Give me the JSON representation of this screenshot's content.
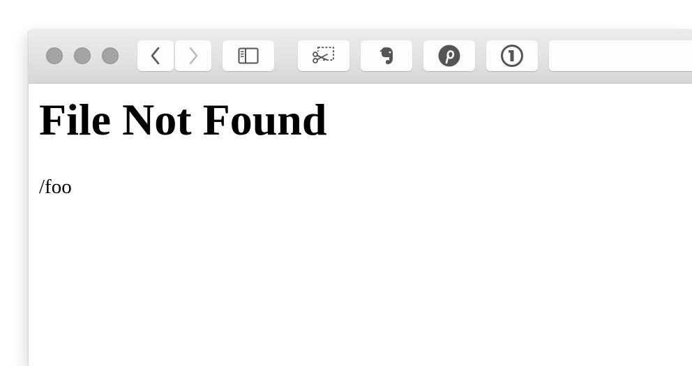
{
  "browser": {
    "toolbar": {
      "traffic_lights": [
        "close",
        "minimize",
        "zoom"
      ],
      "buttons": [
        {
          "name": "back-button",
          "icon": "chevron-left-icon",
          "enabled": true
        },
        {
          "name": "forward-button",
          "icon": "chevron-right-icon",
          "enabled": false
        },
        {
          "name": "sidebar-toggle-button",
          "icon": "sidebar-icon"
        },
        {
          "name": "clip-extension-button",
          "icon": "scissors-clip-icon"
        },
        {
          "name": "evernote-extension-button",
          "icon": "evernote-icon"
        },
        {
          "name": "pinterest-extension-button",
          "icon": "pinterest-icon"
        },
        {
          "name": "1password-extension-button",
          "icon": "1password-icon"
        }
      ],
      "address_bar": {
        "value": ""
      }
    },
    "colors": {
      "icon": "#555555",
      "icon_disabled": "#bdbdbd",
      "traffic_light": "#a3a3a3"
    }
  },
  "page": {
    "title": "File Not Found",
    "path": "/foo"
  }
}
